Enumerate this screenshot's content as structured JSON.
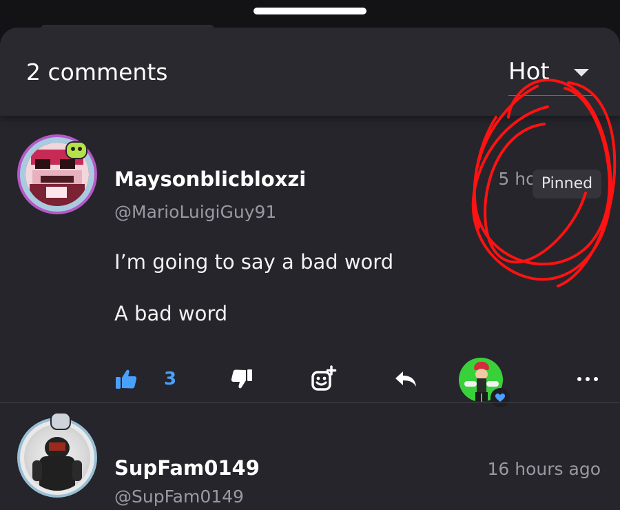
{
  "sheet": {
    "comment_count": "2 comments",
    "sort": {
      "selected": "Hot"
    }
  },
  "comments": [
    {
      "username": "Maysonblicbloxzi",
      "handle": "@MarioLuigiGuy91",
      "timestamp": "5 hours ago",
      "pinned_label": "Pinned",
      "lines": [
        "I’m going to say a bad word",
        "A bad word"
      ],
      "likes": "3",
      "reactor_heart_color": "#4aa0ff"
    },
    {
      "username": "SupFam0149",
      "handle": "@SupFam0149",
      "timestamp": "16 hours ago"
    }
  ],
  "icons": {
    "like": "thumbs-up-icon",
    "dislike": "thumbs-down-icon",
    "react": "add-reaction-icon",
    "reply": "reply-icon",
    "more": "more-icon"
  },
  "colors": {
    "sheet_bg": "#26252b",
    "accent": "#4aa0ff",
    "muted_text": "#9a99a3",
    "annotation": "#ff1212"
  }
}
